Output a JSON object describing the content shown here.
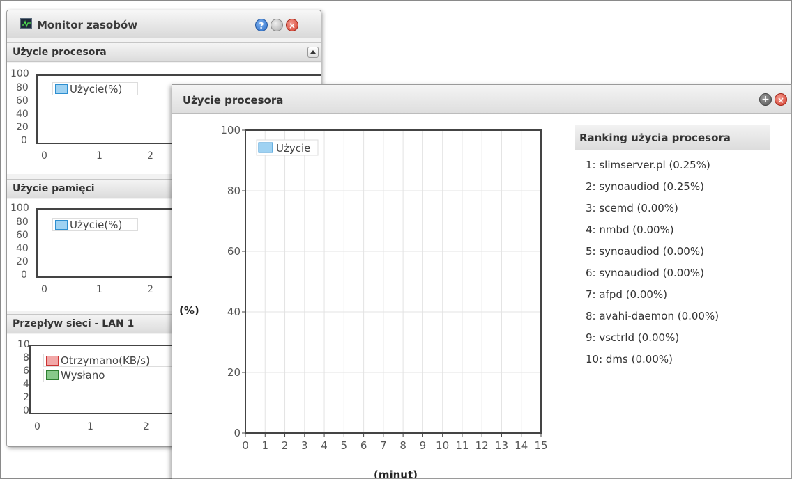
{
  "resource_monitor": {
    "title": "Monitor zasobów",
    "sections": {
      "cpu": {
        "header": "Użycie procesora",
        "legend": "Użycie(%)",
        "y_ticks": [
          "100",
          "80",
          "60",
          "40",
          "20",
          "0"
        ],
        "x_ticks": [
          "0",
          "1",
          "2"
        ]
      },
      "memory": {
        "header": "Użycie pamięci",
        "legend": "Użycie(%)",
        "y_ticks": [
          "100",
          "80",
          "60",
          "40",
          "20",
          "0"
        ],
        "x_ticks": [
          "0",
          "1",
          "2"
        ]
      },
      "network": {
        "header": "Przepływ sieci - LAN 1",
        "legend_received": "Otrzymano(KB/s)",
        "legend_sent": "Wysłano",
        "y_ticks": [
          "10",
          "8",
          "6",
          "4",
          "2",
          "0"
        ],
        "x_ticks": [
          "0",
          "1",
          "2"
        ]
      }
    }
  },
  "cpu_window": {
    "title": "Użycie procesora",
    "ranking_header": "Ranking użycia procesora",
    "ranking": [
      "1: slimserver.pl (0.25%)",
      "2: synoaudiod (0.25%)",
      "3: scemd (0.00%)",
      "4: nmbd (0.00%)",
      "5: synoaudiod (0.00%)",
      "6: synoaudiod (0.00%)",
      "7: afpd (0.00%)",
      "8: avahi-daemon (0.00%)",
      "9: vsctrld (0.00%)",
      "10: dms (0.00%)"
    ]
  },
  "chart_data": {
    "type": "line",
    "title": "Użycie procesora",
    "xlabel": "(minut)",
    "ylabel": "(%)",
    "xlim": [
      0,
      15
    ],
    "ylim": [
      0,
      100
    ],
    "x_ticks": [
      0,
      1,
      2,
      3,
      4,
      5,
      6,
      7,
      8,
      9,
      10,
      11,
      12,
      13,
      14,
      15
    ],
    "y_ticks": [
      0,
      20,
      40,
      60,
      80,
      100
    ],
    "grid": true,
    "legend_position": "top-left",
    "series": [
      {
        "name": "Użycie",
        "color": "#2e8fd0",
        "values": []
      }
    ]
  },
  "colors": {
    "usage": "#9fd2f2",
    "received": "#f2a7a7",
    "sent": "#88c98a",
    "close": "#d33b2a",
    "help": "#2a6dc8"
  }
}
